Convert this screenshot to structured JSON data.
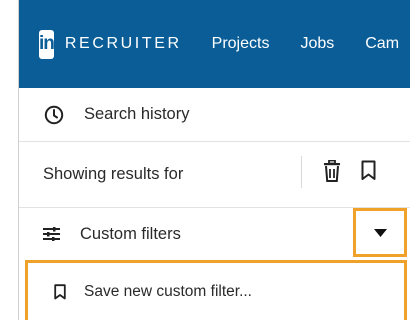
{
  "topbar": {
    "logo_text": "in",
    "brand": "RECRUITER",
    "nav": [
      "Projects",
      "Jobs",
      "Cam"
    ],
    "bg_color": "#0a5d97"
  },
  "history": {
    "label": "Search history",
    "icon": "clock-icon"
  },
  "showing": {
    "label": "Showing results for",
    "icons": [
      "trash-icon",
      "bookmark-icon"
    ]
  },
  "filters": {
    "label": "Custom filters",
    "icon": "sliders-icon",
    "dropdown_icon": "caret-down-icon"
  },
  "menu": {
    "items": [
      {
        "label": "Save new custom filter...",
        "icon": "bookmark-icon"
      }
    ]
  },
  "highlight_color": "#f0a12a"
}
